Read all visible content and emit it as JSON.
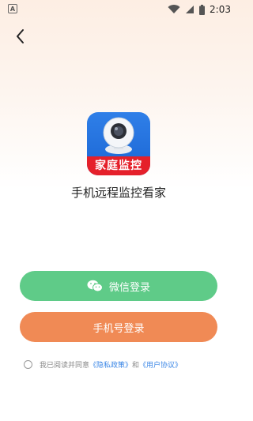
{
  "status_bar": {
    "notification_letter": "A",
    "time": "2:03"
  },
  "app": {
    "icon_banner_text": "家庭监控",
    "name": "手机远程监控看家"
  },
  "buttons": {
    "wechat_login": "微信登录",
    "phone_login": "手机号登录"
  },
  "agreement": {
    "prefix": "我已阅读并同意",
    "privacy_link": "《隐私政策》",
    "conjunction": "和",
    "user_agreement_link": "《用户协议》"
  },
  "colors": {
    "wechat_button": "#5fcb88",
    "phone_button": "#f08a55",
    "link": "#3a86e6",
    "icon_banner": "#e5202a",
    "icon_background": "#1b66d4"
  },
  "icons": {
    "back": "chevron-left-icon",
    "wechat": "wechat-icon",
    "wifi": "wifi-icon",
    "signal": "signal-icon",
    "battery": "battery-icon",
    "camera": "camera-icon"
  }
}
